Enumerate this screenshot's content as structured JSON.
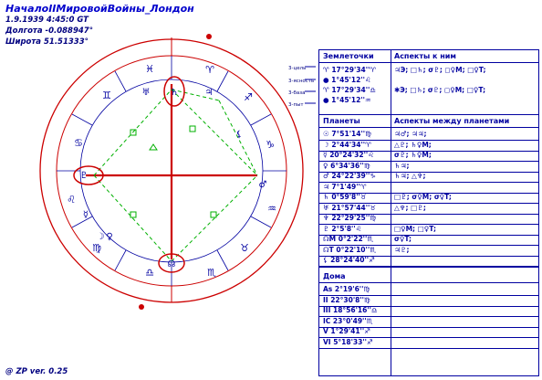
{
  "header": {
    "title": "НачалоIIМировойВойны_Лондон",
    "datetime": "1.9.1939 4:45:0 GT",
    "longitude": "Долгота -0.088947°",
    "latitude": "Широта 51.51333°"
  },
  "footer": {
    "text": "@ ZP  ver. 0.25"
  },
  "axis_labels": [
    "3-цель",
    "3-ясность",
    "3-база",
    "3-пыт"
  ],
  "table": {
    "section1": {
      "col1": "Землеточки",
      "col2": "Аспекты к ним"
    },
    "earth_points": [
      {
        "pos": "♈ 17°29'34''♈",
        "aspects": "♃Э; □♄; σ♇; ◻♀M; □♀T;"
      },
      {
        "pos": "● 1°45'12''♌",
        "aspects": ""
      },
      {
        "pos": "♈ 17°29'34''♎",
        "aspects": "✱Э; □♄; σ♇; ◻♀M; □♀T;"
      },
      {
        "pos": "● 1°45'12''♒",
        "aspects": ""
      }
    ],
    "section2": {
      "col1": "Планеты",
      "col2": "Аспекты между планетами"
    },
    "planets": [
      {
        "pos": "☉ 7°51'14''♍",
        "aspects": "♃♂; ♃♃;"
      },
      {
        "pos": "☽ 2°44'34''♈",
        "aspects": "△♇; ♄♀M;"
      },
      {
        "pos": "☿ 20°24'32''♌",
        "aspects": "σ♇; ♄♀M;"
      },
      {
        "pos": "♀ 6°34'36''♍",
        "aspects": "♄♃;"
      },
      {
        "pos": "♂ 24°22'39''♑",
        "aspects": "♄♃; △♆;"
      },
      {
        "pos": "♃ 7°1'49''♈",
        "aspects": ""
      },
      {
        "pos": "♄ 0°59'8''♉",
        "aspects": "□♇; σ♀M; σ♀T;"
      },
      {
        "pos": "♅ 21°57'44''♉",
        "aspects": "△♆; □♇;"
      },
      {
        "pos": "♆ 22°29'25''♍",
        "aspects": ""
      },
      {
        "pos": "♇ 2°5'8''♌",
        "aspects": "□♀M; □♀T;"
      },
      {
        "pos": "☊M 0°2'22''♏",
        "aspects": "σ♀T;"
      },
      {
        "pos": "☊T 0°22'10''♏",
        "aspects": "♃♇;"
      },
      {
        "pos": "⚸ 28°24'40''♐",
        "aspects": ""
      }
    ],
    "section3": {
      "col1": "Дома"
    },
    "houses": [
      "As 2°19'6''♍",
      "II 22°30'8''♍",
      "III 18°56'16''♎",
      "IC 23°0'49''♏",
      "V 1°29'41''♐",
      "VI 5°18'33''♐"
    ]
  },
  "zodiac_glyphs": [
    "♈",
    "♉",
    "♊",
    "♋",
    "♌",
    "♍",
    "♎",
    "♏",
    "♐",
    "♑",
    "♒",
    "♓"
  ],
  "chart_planet_glyphs": [
    "♄",
    "♃",
    "♅",
    "♇",
    "☿",
    "♀",
    "☽",
    "♂",
    "☊",
    "⚸"
  ],
  "colors": {
    "blue": "#0000a0",
    "red": "#cc0000",
    "green": "#00b000"
  }
}
